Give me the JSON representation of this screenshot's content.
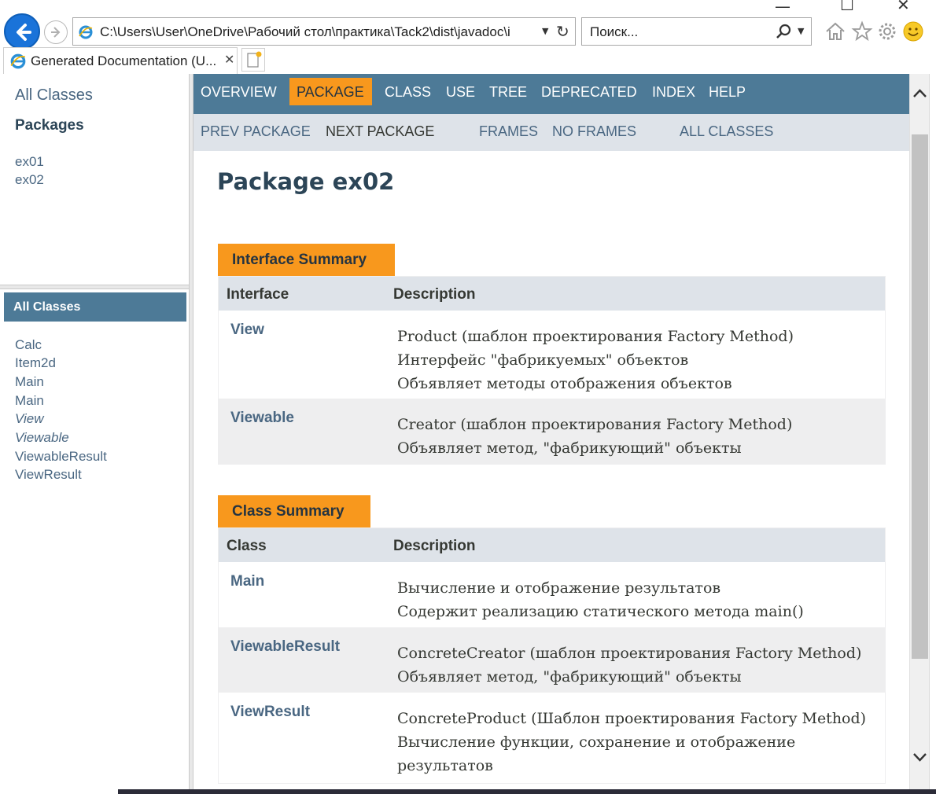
{
  "browser": {
    "address": "C:\\Users\\User\\OneDrive\\Рабочий стол\\практика\\Tack2\\dist\\javadoc\\i",
    "search_placeholder": "Поиск...",
    "tab_title": "Generated Documentation (U...",
    "icons": [
      "back-arrow-icon",
      "forward-arrow-icon",
      "refresh-icon",
      "search-icon",
      "home-icon",
      "favorites-star-icon",
      "settings-gear-icon",
      "smiley-feedback-icon"
    ]
  },
  "sidebar": {
    "all_classes_link": "All Classes",
    "packages_title": "Packages",
    "packages": [
      "ex01",
      "ex02"
    ],
    "all_classes_bar": "All Classes",
    "classes": [
      {
        "name": "Calc",
        "italic": false
      },
      {
        "name": "Item2d",
        "italic": false
      },
      {
        "name": "Main",
        "italic": false
      },
      {
        "name": "Main",
        "italic": false
      },
      {
        "name": "View",
        "italic": true
      },
      {
        "name": "Viewable",
        "italic": true
      },
      {
        "name": "ViewableResult",
        "italic": false
      },
      {
        "name": "ViewResult",
        "italic": false
      }
    ]
  },
  "topnav": {
    "overview": "OVERVIEW",
    "package": "PACKAGE",
    "class": "CLASS",
    "use": "USE",
    "tree": "TREE",
    "deprecated": "DEPRECATED",
    "index": "INDEX",
    "help": "HELP"
  },
  "subnav": {
    "prev_package": "PREV PACKAGE",
    "next_package": "NEXT PACKAGE",
    "frames": "FRAMES",
    "no_frames": "NO FRAMES",
    "all_classes": "ALL CLASSES"
  },
  "page_title": "Package ex02",
  "interface_summary": {
    "caption": "Interface Summary",
    "col_name": "Interface",
    "col_desc": "Description",
    "rows": [
      {
        "name": "View",
        "lines": [
          "Product (шаблон проектирования Factory Method)",
          "Интерфейс \"фабрикуемых\" объектов",
          "Объявляет методы отображения объектов"
        ]
      },
      {
        "name": "Viewable",
        "lines": [
          "Creator (шаблон проектирования Factory Method)",
          "Объявляет метод, \"фабрикующий\" объекты"
        ]
      }
    ]
  },
  "class_summary": {
    "caption": "Class Summary",
    "col_name": "Class",
    "col_desc": "Description",
    "rows": [
      {
        "name": "Main",
        "lines": [
          "Вычисление и отображение результатов",
          "Содержит реализацию статического метода main()"
        ]
      },
      {
        "name": "ViewableResult",
        "lines": [
          "ConcreteCreator (шаблон проектирования Factory Method)",
          "Объявляет метод, \"фабрикующий\" объекты"
        ]
      },
      {
        "name": "ViewResult",
        "lines": [
          "ConcreteProduct (Шаблон проектирования Factory Method)",
          "Вычисление функции, сохранение и отображение",
          "результатов"
        ]
      }
    ]
  },
  "colors": {
    "nav_blue": "#4d7a97",
    "accent_orange": "#f8981d",
    "header_gray": "#dee3e9",
    "link": "#4a6782",
    "row_alt": "#eeeeef"
  }
}
